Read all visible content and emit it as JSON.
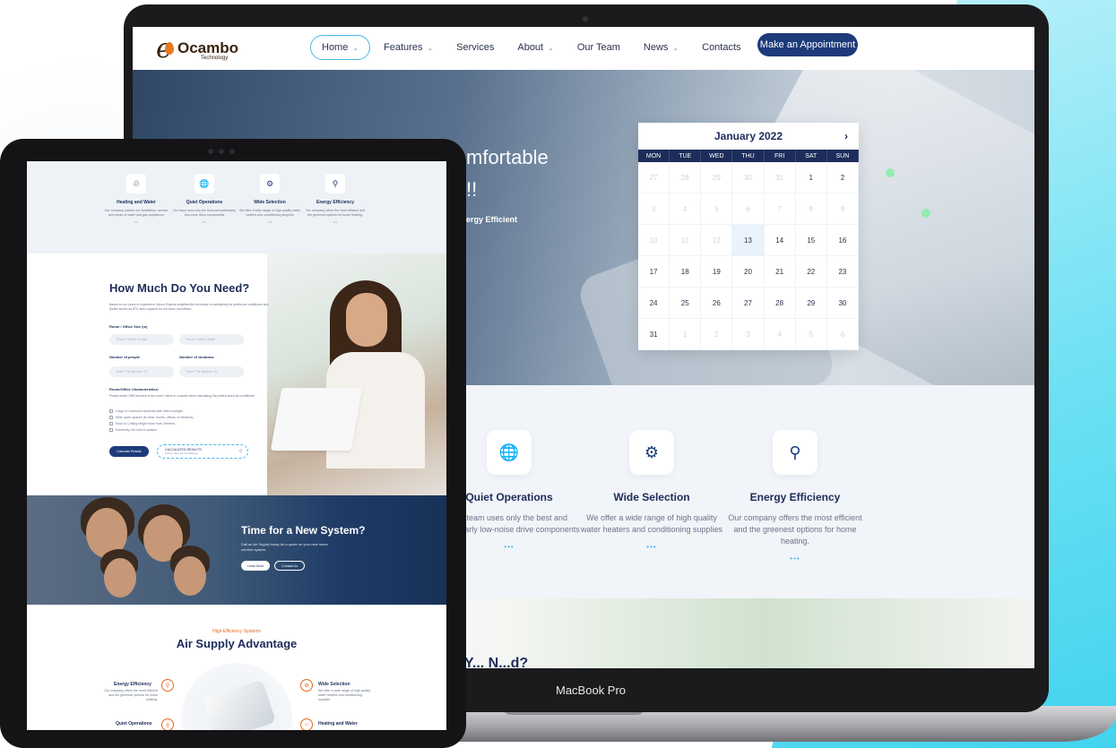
{
  "laptop_label": "MacBook Pro",
  "site": {
    "logo": {
      "initial": "e",
      "word": "Ocambo",
      "sub": "Technology"
    },
    "nav": [
      {
        "label": "Home",
        "dropdown": true
      },
      {
        "label": "Features",
        "dropdown": true
      },
      {
        "label": "Services",
        "dropdown": false
      },
      {
        "label": "About",
        "dropdown": true
      },
      {
        "label": "Our Team",
        "dropdown": false
      },
      {
        "label": "News",
        "dropdown": true
      },
      {
        "label": "Contacts",
        "dropdown": false
      }
    ],
    "cta": "Make an Appointment",
    "hero": {
      "line1": "mfortable",
      "line2": "!!",
      "sub": "ergy Efficient"
    },
    "calendar": {
      "month": "January 2022",
      "next_icon": "chevron-right-icon",
      "weekdays": [
        "MON",
        "TUE",
        "WED",
        "THU",
        "FRI",
        "SAT",
        "SUN"
      ],
      "days": [
        [
          "27",
          "28",
          "29",
          "30",
          "31",
          "1",
          "2"
        ],
        [
          "3",
          "4",
          "5",
          "6",
          "7",
          "8",
          "9"
        ],
        [
          "10",
          "11",
          "12",
          "13",
          "14",
          "15",
          "16"
        ],
        [
          "17",
          "18",
          "19",
          "20",
          "21",
          "22",
          "23"
        ],
        [
          "24",
          "25",
          "26",
          "27",
          "28",
          "29",
          "30"
        ],
        [
          "31",
          "1",
          "2",
          "3",
          "4",
          "5",
          "6"
        ]
      ],
      "today": "13"
    },
    "features": [
      {
        "icon": "globe-icon",
        "title": "Quiet Operations",
        "desc": "Our team uses only the best and particularly low-noise drive components",
        "dots": "•••"
      },
      {
        "icon": "gear-icon",
        "title": "Wide Selection",
        "desc": "We offer a wide range of high quality water heaters and conditioning supplies",
        "dots": "•••"
      },
      {
        "icon": "faucet-icon",
        "title": "Energy Efficiency",
        "desc": "Our company offers the most efficient and the greenest options for home heating.",
        "dots": "•••"
      }
    ],
    "bottom_partial": "Y... N...d?"
  },
  "tablet": {
    "features": [
      {
        "icon": "recycle-icon",
        "title": "Heating and Water",
        "desc": "Our company carries out installation, service and repair of water and gas appliances",
        "dots": "•••"
      },
      {
        "icon": "globe-icon",
        "title": "Quiet Operations",
        "desc": "Our team uses only the best and particularly low-noise drive components",
        "dots": "•••"
      },
      {
        "icon": "gear-icon",
        "title": "Wide Selection",
        "desc": "We offer a wide range of high quality water heaters and conditioning supplies",
        "dots": "•••"
      },
      {
        "icon": "faucet-icon",
        "title": "Energy Efficiency",
        "desc": "Our company offers the most efficient and the greenest options for home heating.",
        "dots": "•••"
      }
    ],
    "calc": {
      "title": "How Much Do You Need?",
      "intro": "Based on our years of experience, Aircon Experts simplified the technique of calculating the perfect air conditioner size (better known as BTU size) required for all rooms and offices.",
      "room_label": "Room / Office Size (m)",
      "room_length_placeholder": "Room / Office Length",
      "room_width_placeholder": "Room / Office Width",
      "people_label": "Number of people",
      "windows_label": "Number of windows:",
      "people_placeholder": "Enter The Number Of",
      "windows_placeholder": "Enter The Number Of",
      "char_label": "Room/Office Characteristics:",
      "char_note": "Please select ONE element of the room / office to consider when calculating the perfect sized air conditioner.",
      "options": [
        "Large or oversized windows with direct sunlight",
        "Wide open spaces (in other rooms, offices or kitchens)",
        "Floor to Ceiling height more than 3meters",
        "Extremely hot hold in season"
      ],
      "calc_button": "Calculate Results",
      "results_title": "CALCULATED RESULTS",
      "results_sub": "Perfect Size Air Conditioner",
      "results_value": "0"
    },
    "promo": {
      "title": "Time for a New System?",
      "text": "Call an Air Supply today for a quote on your new home comfort system.",
      "learn_more": "Learn More",
      "contact_us": "Contact Us"
    },
    "advantage": {
      "kicker": "High-Efficiency Systems",
      "title": "Air Supply Advantage",
      "left": [
        {
          "title": "Energy Efficiency",
          "desc": "Our company offers the most efficient and the greenest options for home heating.",
          "icon": "faucet-icon"
        },
        {
          "title": "Quiet Operations",
          "desc": "",
          "icon": "globe-icon"
        }
      ],
      "right": [
        {
          "title": "Wide Selection",
          "desc": "We offer a wide range of high quality water heaters and conditioning supplies",
          "icon": "gear-icon"
        },
        {
          "title": "Heating and Water",
          "desc": "",
          "icon": "recycle-icon"
        }
      ]
    }
  }
}
